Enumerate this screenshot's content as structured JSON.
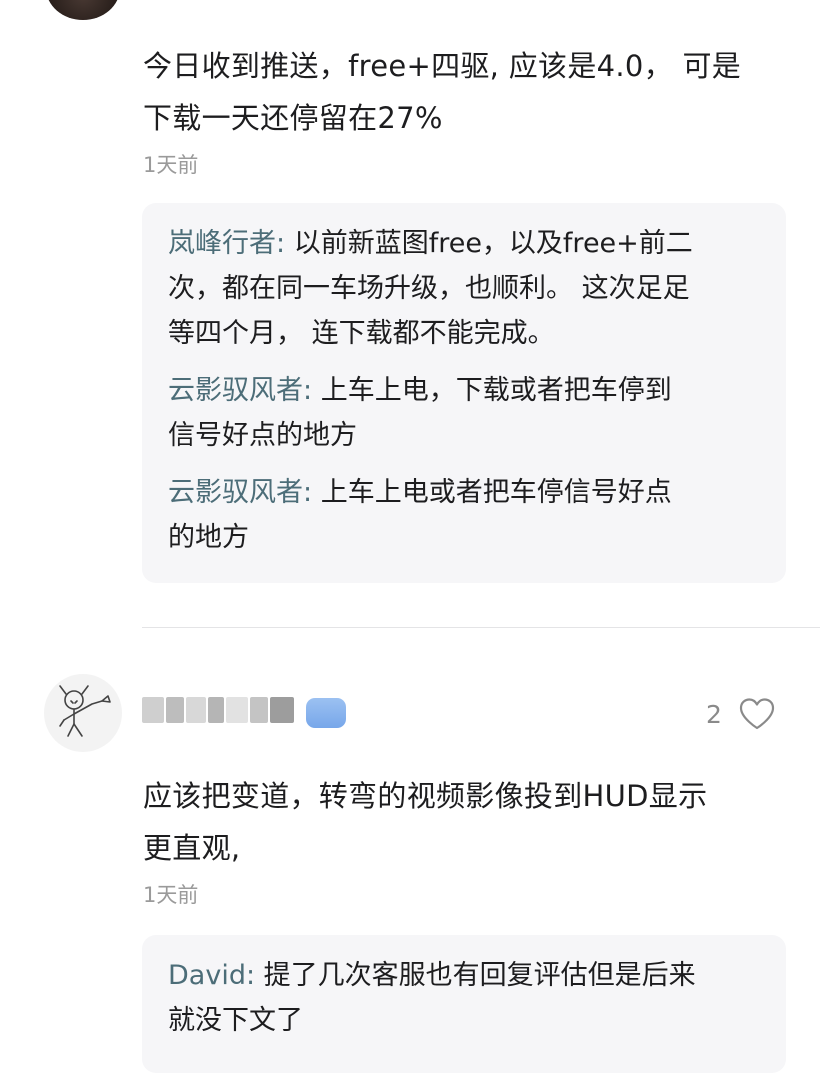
{
  "comment1": {
    "text_line1": "今日收到推送，free+四驱, 应该是4.0，  可是",
    "text_line2": "下载一天还停留在27%",
    "time": "1天前",
    "replies": [
      {
        "name": "岚峰行者:",
        "line1": " 以前新蓝图free，以及free+前二",
        "line2": "次，都在同一车场升级，也顺利。 这次足足",
        "line3": "等四个月，  连下载都不能完成。"
      },
      {
        "name": "云影驭风者:",
        "line1": " 上车上电，下载或者把车停到",
        "line2": "信号好点的地方"
      },
      {
        "name": "云影驭风者:",
        "line1": " 上车上电或者把车停信号好点",
        "line2": "的地方"
      }
    ]
  },
  "comment2": {
    "like_count": "2",
    "text_line1": "应该把变道，转弯的视频影像投到HUD显示",
    "text_line2": "更直观,",
    "time": "1天前",
    "replies": [
      {
        "name": "David:",
        "line1": " 提了几次客服也有回复评估但是后来",
        "line2": "就没下文了"
      }
    ]
  }
}
